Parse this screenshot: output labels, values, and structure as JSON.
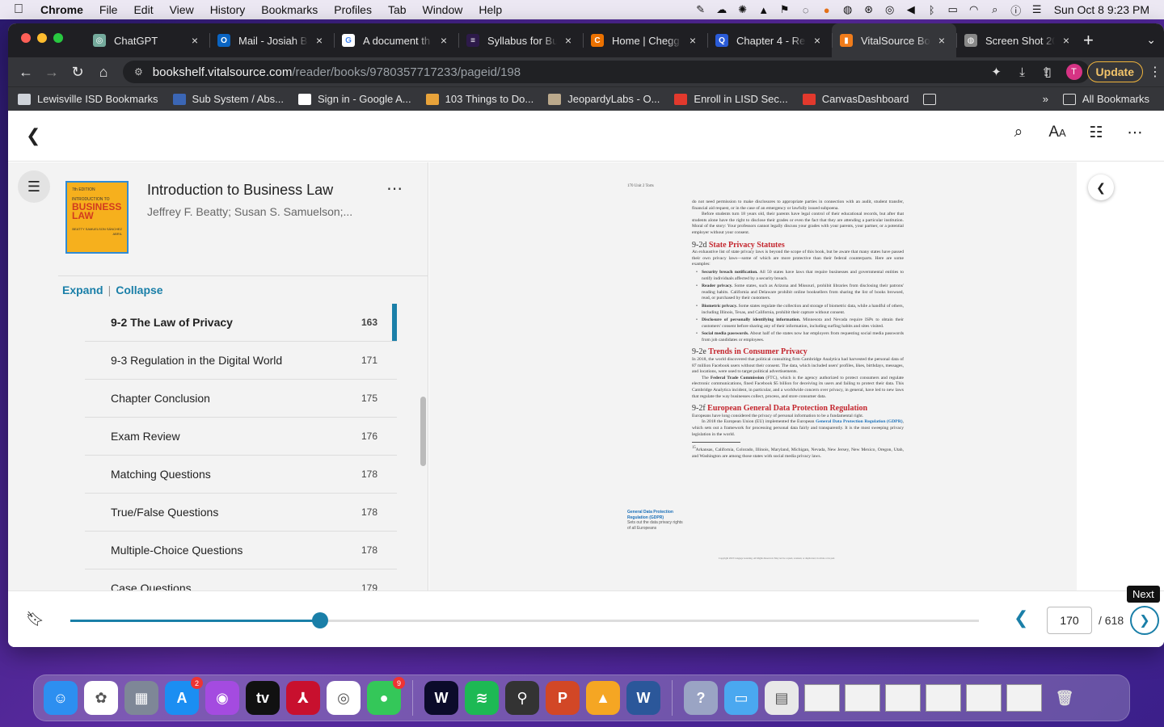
{
  "menubar": {
    "app": "Chrome",
    "items": [
      "File",
      "Edit",
      "View",
      "History",
      "Bookmarks",
      "Profiles",
      "Tab",
      "Window",
      "Help"
    ],
    "clock": "Sun Oct 8  9:23 PM"
  },
  "tabs": [
    {
      "title": "ChatGPT",
      "color": "#74aa9c",
      "glyph": "◎"
    },
    {
      "title": "Mail - Josiah B",
      "color": "#0a64c2",
      "glyph": "O"
    },
    {
      "title": "A document th",
      "color": "#ffffff",
      "glyph": "G"
    },
    {
      "title": "Syllabus for Bu",
      "color": "#2d1a4a",
      "glyph": "≡"
    },
    {
      "title": "Home | Chegg",
      "color": "#eb7100",
      "glyph": "C"
    },
    {
      "title": "Chapter 4 - Re",
      "color": "#2a5bd7",
      "glyph": "Q"
    },
    {
      "title": "VitalSource Bo",
      "color": "#f07c1b",
      "glyph": "▮"
    },
    {
      "title": "Screen Shot 20",
      "color": "#888888",
      "glyph": "◍"
    }
  ],
  "address": {
    "host": "bookshelf.vitalsource.com",
    "path": "/reader/books/9780357717233/pageid/198"
  },
  "toolbar": {
    "avatar_initial": "T",
    "update_label": "Update"
  },
  "bookmarks": [
    {
      "label": "Lewisville ISD Bookmarks",
      "color": "#cfd3da"
    },
    {
      "label": "Sub System / Abs...",
      "color": "#3b66b5"
    },
    {
      "label": "Sign in - Google A...",
      "color": "#ffffff"
    },
    {
      "label": "103 Things to Do...",
      "color": "#e8a33a"
    },
    {
      "label": "JeopardyLabs - O...",
      "color": "#bba98c"
    },
    {
      "label": "Enroll in LISD Sec...",
      "color": "#e2392d"
    },
    {
      "label": "CanvasDashboard",
      "color": "#e2392d"
    }
  ],
  "bookmarks_right": {
    "more": "»",
    "all": "All Bookmarks"
  },
  "book": {
    "title": "Introduction to Business Law",
    "authors": "Jeffrey F. Beatty; Susan S. Samuelson;...",
    "cover_edition": "7th EDITION",
    "cover_title": "BUSINESS LAW",
    "cover_kicker": "INTRODUCTION TO",
    "cover_authors": "BEATTY SAMUELSON SÁNCHEZ ABRIL"
  },
  "toc": {
    "expand_label": "Expand",
    "collapse_label": "Collapse",
    "items": [
      {
        "label": "9-2 The Law of Privacy",
        "page": "163",
        "current": true
      },
      {
        "label": "9-3 Regulation in the Digital World",
        "page": "171"
      },
      {
        "label": "Chapter Conclusion",
        "page": "175"
      },
      {
        "label": "Exam Review",
        "page": "176"
      },
      {
        "label": "Matching Questions",
        "page": "178"
      },
      {
        "label": "True/False Questions",
        "page": "178"
      },
      {
        "label": "Multiple-Choice Questions",
        "page": "178"
      },
      {
        "label": "Case Questions",
        "page": "179"
      }
    ]
  },
  "page_content": {
    "running_head": "170         Unit 2    Torts",
    "intro_p1": "do not need permission to make disclosures to appropriate parties in connection with an audit, student transfer, financial aid request, or in the case of an emergency or lawfully issued subpoena.",
    "intro_p2": "Before students turn 18 years old, their parents have legal control of their educational records, but after that students alone have the right to disclose their grades or even the fact that they are attending a particular institution. Moral of the story: Your professors cannot legally discuss your grades with your parents, your partner, or a potential employer without your consent.",
    "h_2d_num": "9-2d",
    "h_2d_title": "State Privacy Statutes",
    "p_2d": "An exhaustive list of state privacy laws is beyond the scope of this book, but be aware that many states have passed their own privacy laws—some of which are more protective than their federal counterparts. Here are some examples:",
    "bullets": [
      {
        "lead": "Security breach notification.",
        "text": "All 50 states have laws that require businesses and governmental entities to notify individuals affected by a security breach."
      },
      {
        "lead": "Reader privacy.",
        "text": "Some states, such as Arizona and Missouri, prohibit libraries from disclosing their patrons' reading habits. California and Delaware prohibit online booksellers from sharing the list of books browsed, read, or purchased by their customers."
      },
      {
        "lead": "Biometric privacy.",
        "text": "Some states regulate the collection and storage of biometric data, while a handful of others, including Illinois, Texas, and California, prohibit their capture without consent."
      },
      {
        "lead": "Disclosure of personally identifying information.",
        "text": "Minnesota and Nevada require ISPs to obtain their customers' consent before sharing any of their information, including surfing habits and sites visited."
      },
      {
        "lead": "Social media passwords.",
        "text": "About half of the states now bar employers from requesting social media passwords from job candidates or employees."
      }
    ],
    "h_2e_num": "9-2e",
    "h_2e_title": "Trends in Consumer Privacy",
    "p_2e1": "In 2018, the world discovered that political consulting firm Cambridge Analytica had harvested the personal data of 87 million Facebook users without their consent. The data, which included users' profiles, likes, birthdays, messages, and locations, were used to target political advertisements.",
    "p_2e2_lead": "The",
    "p_2e2_bold": "Federal Trade Commission",
    "p_2e2": "(FTC), which is the agency authorized to protect consumers and regulate electronic communications, fined Facebook $5 billion for deceiving its users and failing to protect their data. This Cambridge Analytica incident, in particular, and a worldwide concern over privacy, in general, have led to new laws that regulate the way businesses collect, process, and store consumer data.",
    "h_2f_num": "9-2f",
    "h_2f_title": "European General Data Protection Regulation",
    "p_2f1": "Europeans have long considered the privacy of personal information to be a fundamental right.",
    "p_2f2_lead": "In 2018 the European Union (EU) implemented the European",
    "p_2f2_term": "General Data Protection Regulation (GDPR)",
    "p_2f2": ", which sets out a framework for processing personal data fairly and transparently. It is the most sweeping privacy legislation in the world.",
    "margin_term": "General Data Protection Regulation (GDPR)",
    "margin_def": "Sets out the data privacy rights of all Europeans",
    "footnote": "Arkansas, California, Colorado, Illinois, Maryland, Michigan, Nevada, New Jersey, New Mexico, Oregon, Utah, and Washington are among those states with social media privacy laws.",
    "footnote_mark": "15",
    "copyright": "Copyright 2023 Cengage Learning. All Rights Reserved. May not be copied, scanned, or duplicated, in whole or in part."
  },
  "footer": {
    "progress": 0.275,
    "current_page": "170",
    "total_pages": "/ 618",
    "tooltip": "Next"
  },
  "dock": [
    {
      "name": "finder",
      "color": "#2d8ff0",
      "glyph": "☺"
    },
    {
      "name": "photos-app",
      "color": "#ffffff",
      "glyph": "✿"
    },
    {
      "name": "launchpad",
      "color": "#7e8797",
      "glyph": "▦"
    },
    {
      "name": "app-store",
      "color": "#1b8ef2",
      "glyph": "A",
      "badge": "2"
    },
    {
      "name": "podcasts",
      "color": "#a44be0",
      "glyph": "◉"
    },
    {
      "name": "apple-tv",
      "color": "#111111",
      "glyph": "tv"
    },
    {
      "name": "acrobat",
      "color": "#c8102e",
      "glyph": "⅄"
    },
    {
      "name": "chrome",
      "color": "#ffffff",
      "glyph": "◎"
    },
    {
      "name": "messages",
      "color": "#34c759",
      "glyph": "●",
      "badge": "9"
    },
    {
      "name": "webex",
      "color": "#0b0b2a",
      "glyph": "W"
    },
    {
      "name": "spotify",
      "color": "#1db954",
      "glyph": "≋"
    },
    {
      "name": "keychain",
      "color": "#333333",
      "glyph": "⚲"
    },
    {
      "name": "powerpoint",
      "color": "#d24726",
      "glyph": "P"
    },
    {
      "name": "keynote",
      "color": "#f5a623",
      "glyph": "▲"
    },
    {
      "name": "word",
      "color": "#2b579a",
      "glyph": "W"
    },
    {
      "name": "help",
      "color": "#9aa4c4",
      "glyph": "?"
    },
    {
      "name": "folder",
      "color": "#4aa8f0",
      "glyph": "▭"
    },
    {
      "name": "png-file",
      "color": "#e8e8e8",
      "glyph": "▤"
    }
  ]
}
